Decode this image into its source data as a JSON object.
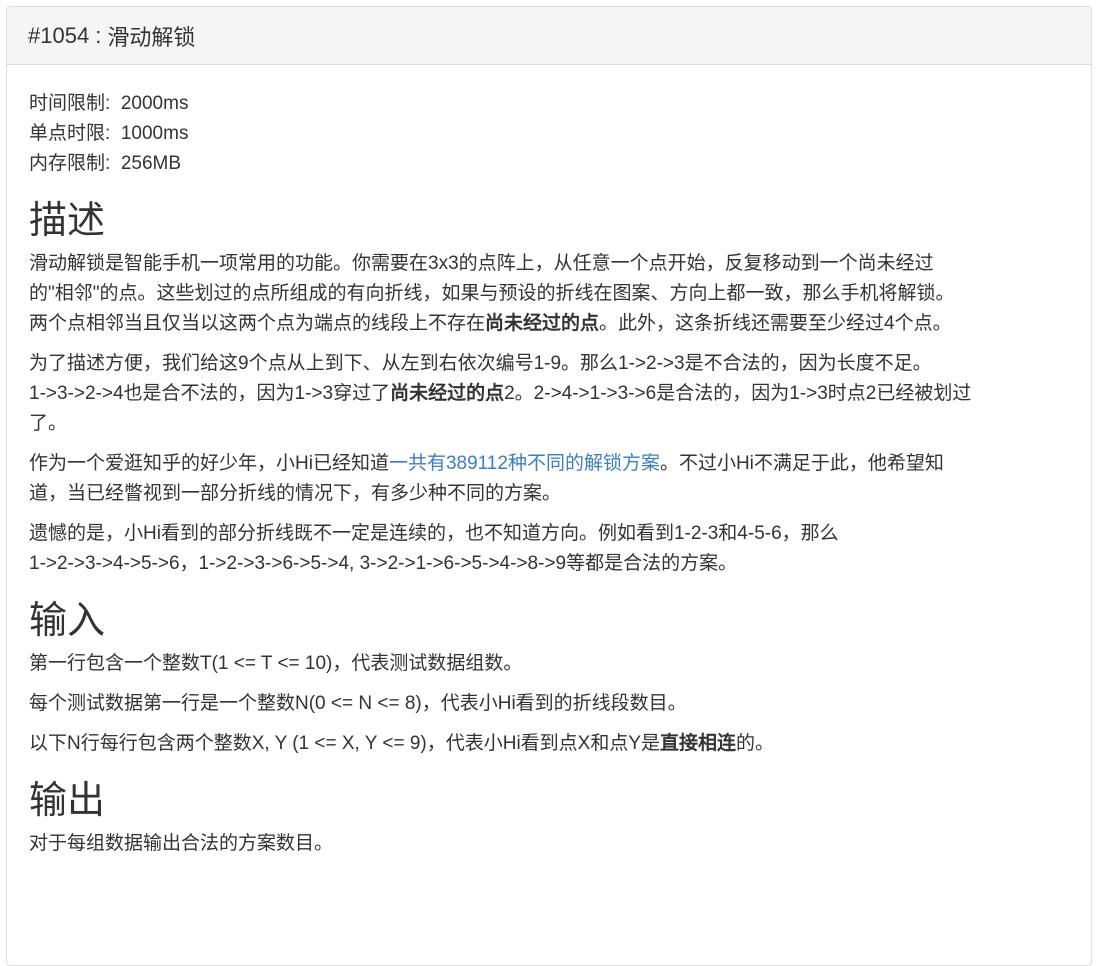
{
  "header": {
    "problem_id": "#1054",
    "separator": ":",
    "title": "滑动解锁"
  },
  "limits": {
    "time_label": "时间限制:",
    "time_value": "2000ms",
    "single_label": "单点时限:",
    "single_value": "1000ms",
    "memory_label": "内存限制:",
    "memory_value": "256MB"
  },
  "description": {
    "heading": "描述",
    "p1_line1": "滑动解锁是智能手机一项常用的功能。你需要在3x3的点阵上，从任意一个点开始，反复移动到一个尚未经过",
    "p1_line2": "的\"相邻\"的点。这些划过的点所组成的有向折线，如果与预设的折线在图案、方向上都一致，那么手机将解锁。",
    "p1_line3a": "两个点相邻当且仅当以这两个点为端点的线段上不存在",
    "p1_line3b": "尚未经过的点",
    "p1_line3c": "。此外，这条折线还需要至少经过4个点。",
    "p2_line1": "为了描述方便，我们给这9个点从上到下、从左到右依次编号1-9。那么1->2->3是不合法的，因为长度不足。",
    "p2_line2a": "1->3->2->4也是合不法的，因为1->3穿过了",
    "p2_line2b": "尚未经过的点",
    "p2_line2c": "2。2->4->1->3->6是合法的，因为1->3时点2已经被划过",
    "p2_line3": "了。",
    "p3_line1a": "作为一个爱逛知乎的好少年，小Hi已经知道",
    "p3_link": "一共有389112种不同的解锁方案",
    "p3_line1b": "。不过小Hi不满足于此，他希望知",
    "p3_line2": "道，当已经瞥视到一部分折线的情况下，有多少种不同的方案。",
    "p4_line1": "遗憾的是，小Hi看到的部分折线既不一定是连续的，也不知道方向。例如看到1-2-3和4-5-6，那么",
    "p4_line2": "1->2->3->4->5->6，1->2->3->6->5->4, 3->2->1->6->5->4->8->9等都是合法的方案。"
  },
  "input": {
    "heading": "输入",
    "p1": "第一行包含一个整数T(1 <= T <= 10)，代表测试数据组数。",
    "p2": "每个测试数据第一行是一个整数N(0 <= N <= 8)，代表小Hi看到的折线段数目。",
    "p3a": "以下N行每行包含两个整数X, Y (1 <= X, Y <= 9)，代表小Hi看到点X和点Y是",
    "p3b": "直接相连",
    "p3c": "的。"
  },
  "output": {
    "heading": "输出",
    "p1": "对于每组数据输出合法的方案数目。"
  }
}
